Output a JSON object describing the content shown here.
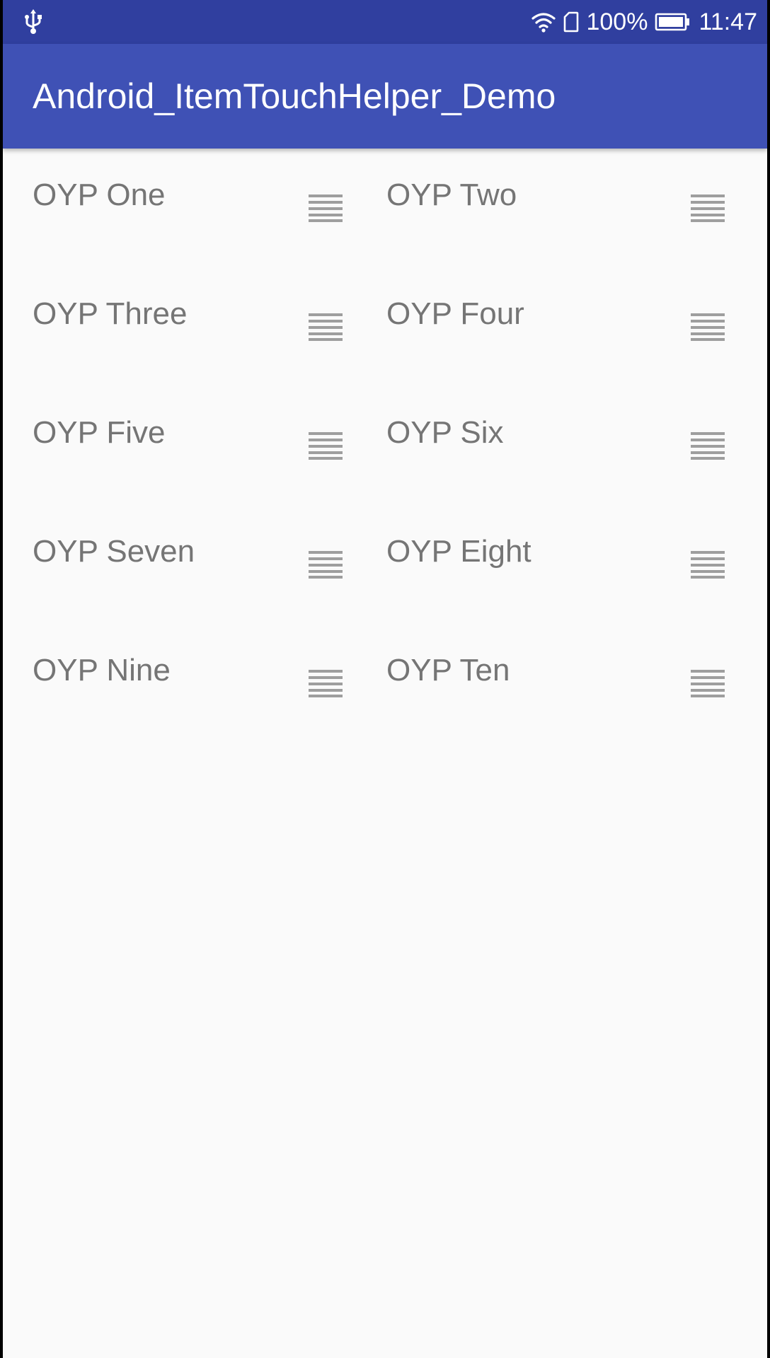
{
  "status_bar": {
    "battery_percent": "100%",
    "time": "11:47",
    "icons": [
      "usb-icon",
      "wifi-icon",
      "sim-icon",
      "battery-icon"
    ],
    "background": "#303f9f"
  },
  "app_bar": {
    "title": "Android_ItemTouchHelper_Demo",
    "background": "#3f51b5"
  },
  "items": [
    {
      "label": "OYP One",
      "handle_icon": "drag-handle-icon"
    },
    {
      "label": "OYP Two",
      "handle_icon": "drag-handle-icon"
    },
    {
      "label": "OYP Three",
      "handle_icon": "drag-handle-icon"
    },
    {
      "label": "OYP Four",
      "handle_icon": "drag-handle-icon"
    },
    {
      "label": "OYP Five",
      "handle_icon": "drag-handle-icon"
    },
    {
      "label": "OYP Six",
      "handle_icon": "drag-handle-icon"
    },
    {
      "label": "OYP Seven",
      "handle_icon": "drag-handle-icon"
    },
    {
      "label": "OYP Eight",
      "handle_icon": "drag-handle-icon"
    },
    {
      "label": "OYP Nine",
      "handle_icon": "drag-handle-icon"
    },
    {
      "label": "OYP Ten",
      "handle_icon": "drag-handle-icon"
    }
  ],
  "colors": {
    "item_text": "#757575",
    "handle": "#9e9e9e",
    "background": "#fafafa"
  }
}
